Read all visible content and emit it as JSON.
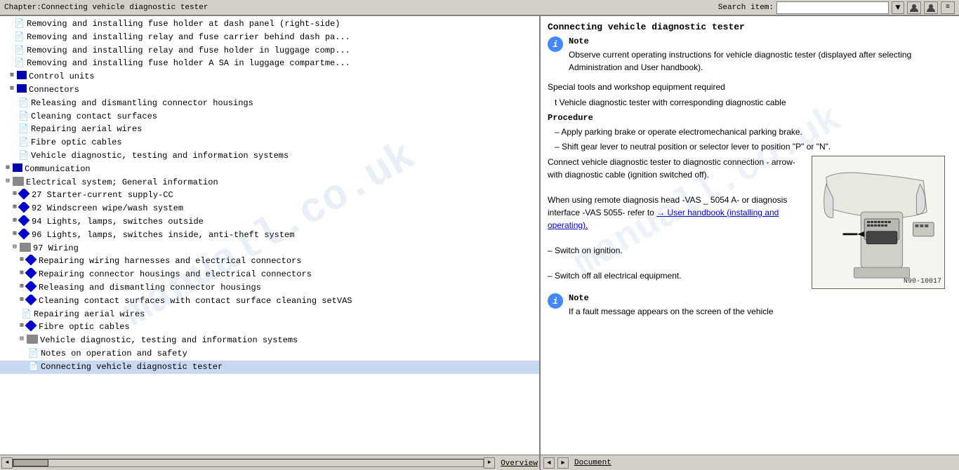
{
  "titleBar": {
    "title": "Chapter:Connecting vehicle diagnostic tester",
    "searchLabel": "Search item:",
    "searchPlaceholder": ""
  },
  "toolbar": {
    "searchDropdownIcon": "▼",
    "btn1": "👤",
    "btn2": "👤",
    "btn3": "≡"
  },
  "leftPanel": {
    "watermark": "manuall.co.uk",
    "items": [
      {
        "indent": 20,
        "type": "doc",
        "text": "Removing and installing fuse holder at dash panel (right-side)"
      },
      {
        "indent": 20,
        "type": "doc",
        "text": "Removing and installing relay and fuse carrier behind dash par"
      },
      {
        "indent": 20,
        "type": "doc",
        "text": "Removing and installing relay and fuse holder in luggage comp"
      },
      {
        "indent": 20,
        "type": "doc",
        "text": "Removing and installing fuse holder A SA in luggage compartme"
      },
      {
        "indent": 10,
        "type": "folder-expand",
        "text": "Control units"
      },
      {
        "indent": 10,
        "type": "folder-expand",
        "text": "Connectors"
      },
      {
        "indent": 20,
        "type": "doc",
        "text": "Releasing and dismantling connector housings"
      },
      {
        "indent": 20,
        "type": "doc",
        "text": "Cleaning contact surfaces"
      },
      {
        "indent": 20,
        "type": "doc",
        "text": "Repairing aerial wires"
      },
      {
        "indent": 20,
        "type": "doc",
        "text": "Fibre optic cables"
      },
      {
        "indent": 20,
        "type": "doc",
        "text": "Vehicle diagnostic, testing and information systems"
      },
      {
        "indent": 4,
        "type": "folder-expand",
        "text": "Communication"
      },
      {
        "indent": 4,
        "type": "folder-open",
        "text": "Electrical system; General information"
      },
      {
        "indent": 14,
        "type": "diamond-expand",
        "text": "27 Starter-current supply-CC"
      },
      {
        "indent": 14,
        "type": "diamond-expand",
        "text": "92 Windscreen wipe/wash system"
      },
      {
        "indent": 14,
        "type": "diamond-expand",
        "text": "94 Lights, lamps, switches outside"
      },
      {
        "indent": 14,
        "type": "diamond-expand",
        "text": "96 Lights, lamps, switches inside, anti-theft system"
      },
      {
        "indent": 14,
        "type": "folder-open",
        "text": "97 Wiring"
      },
      {
        "indent": 24,
        "type": "diamond-expand",
        "text": "Repairing wiring harnesses and electrical connectors"
      },
      {
        "indent": 24,
        "type": "diamond-expand",
        "text": "Repairing connector housings and electrical connectors"
      },
      {
        "indent": 24,
        "type": "diamond-expand",
        "text": "Releasing and dismantling connector housings"
      },
      {
        "indent": 24,
        "type": "diamond-expand",
        "text": "Cleaning contact surfaces with contact surface cleaning setVAS"
      },
      {
        "indent": 24,
        "type": "doc",
        "text": "Repairing aerial wires"
      },
      {
        "indent": 24,
        "type": "diamond-expand",
        "text": "Fibre optic cables"
      },
      {
        "indent": 24,
        "type": "folder-open",
        "text": "Vehicle diagnostic, testing and information systems"
      },
      {
        "indent": 34,
        "type": "doc",
        "text": "Notes on operation and safety"
      },
      {
        "indent": 34,
        "type": "doc",
        "text": "Connecting vehicle diagnostic tester"
      }
    ]
  },
  "rightPanel": {
    "watermark": "manuall.co.uk",
    "title": "Connecting vehicle diagnostic tester",
    "noteLabel": "Note",
    "noteText": "Observe current operating instructions for vehicle diagnostic tester (displayed after selecting Administration and User handbook).",
    "specialToolsLabel": "Special tools and workshop equipment required",
    "toolItem": "t  Vehicle diagnostic tester with corresponding diagnostic cable",
    "procedureLabel": "Procedure",
    "steps": [
      "Apply parking brake or operate electromechanical parking brake.",
      "Shift gear lever to neutral position or selector lever to position \"P\" or \"N\"."
    ],
    "connectText": "Connect vehicle diagnostic tester to diagnostic connection - arrow- with diagnostic cable (ignition switched off).",
    "remoteText": "When using remote diagnosis head -VAS _ 5054 A- or diagnosis interface -VAS 5055- refer to",
    "linkText": "→ User handbook (installing and operating).",
    "switchOnText": "Switch on ignition.",
    "switchOffText": "Switch off all electrical equipment.",
    "note2Label": "Note",
    "note2Text": "If a fault message appears on the screen of the vehicle",
    "imageLabel": "N90-10017"
  },
  "bottomBar": {
    "leftTab": "Overview",
    "rightTab": "Document"
  }
}
